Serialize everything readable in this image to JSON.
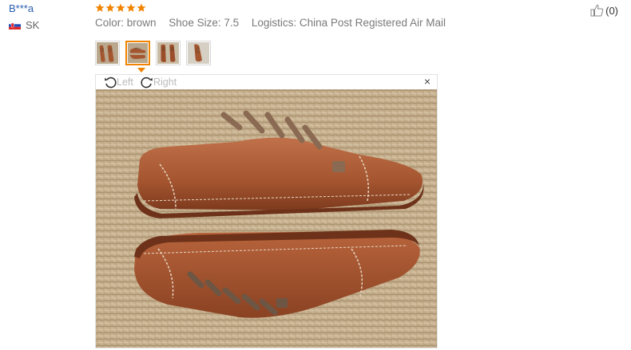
{
  "reviewer": {
    "name": "B***a",
    "country": "SK",
    "flag_icon": "slovakia-flag-icon"
  },
  "rating": {
    "stars": 5,
    "max": 5,
    "color": "#f08300"
  },
  "attributes": {
    "color": "Color: brown",
    "shoe_size": "Shoe Size: 7.5",
    "logistics": "Logistics: China Post Registered Air Mail"
  },
  "helpful": {
    "count": "(0)",
    "icon": "thumbs-up-icon"
  },
  "thumbnails": {
    "count": 4,
    "active_index": 1
  },
  "viewer": {
    "rotate_left_label": "Left",
    "rotate_right_label": "Right",
    "close_label": "×"
  },
  "colors": {
    "accent": "#f08300",
    "link": "#2a5db0",
    "muted": "#7a7a7a",
    "shoe": "#a85a32"
  }
}
